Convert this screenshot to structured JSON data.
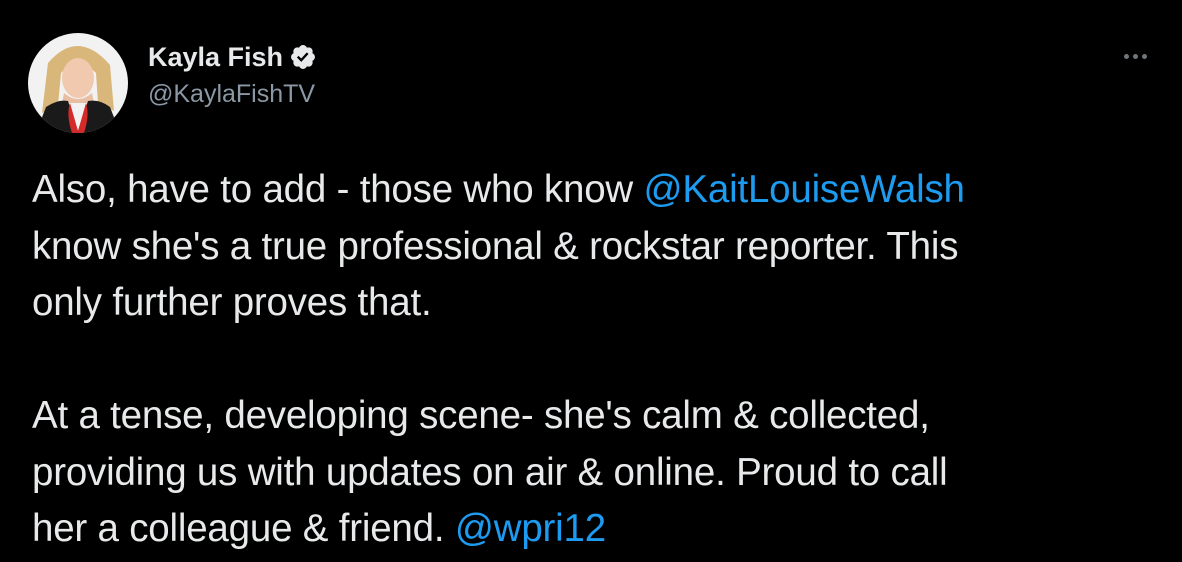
{
  "tweet": {
    "author": {
      "display_name": "Kayla Fish",
      "handle": "@KaylaFishTV",
      "verified": true,
      "verified_icon": "verified-badge-icon",
      "avatar": "profile-photo"
    },
    "more_icon": "more-horizontal-icon",
    "paragraphs": [
      {
        "before": "Also, have to add - those who know ",
        "mention": "@KaitLouiseWalsh",
        "after_line1": "",
        "line2": "know she's a true professional & rockstar reporter. This",
        "line3": "only further proves that."
      },
      {
        "line1": "At a tense, developing scene- she's calm & collected,",
        "line2": "providing us with updates on air & online. Proud to call",
        "line3_before": "her a colleague & friend. ",
        "mention": "@wpri12"
      }
    ]
  },
  "colors": {
    "background": "#000000",
    "text": "#e7e9ea",
    "secondary": "#8b98a5",
    "link": "#1d9bf0"
  }
}
